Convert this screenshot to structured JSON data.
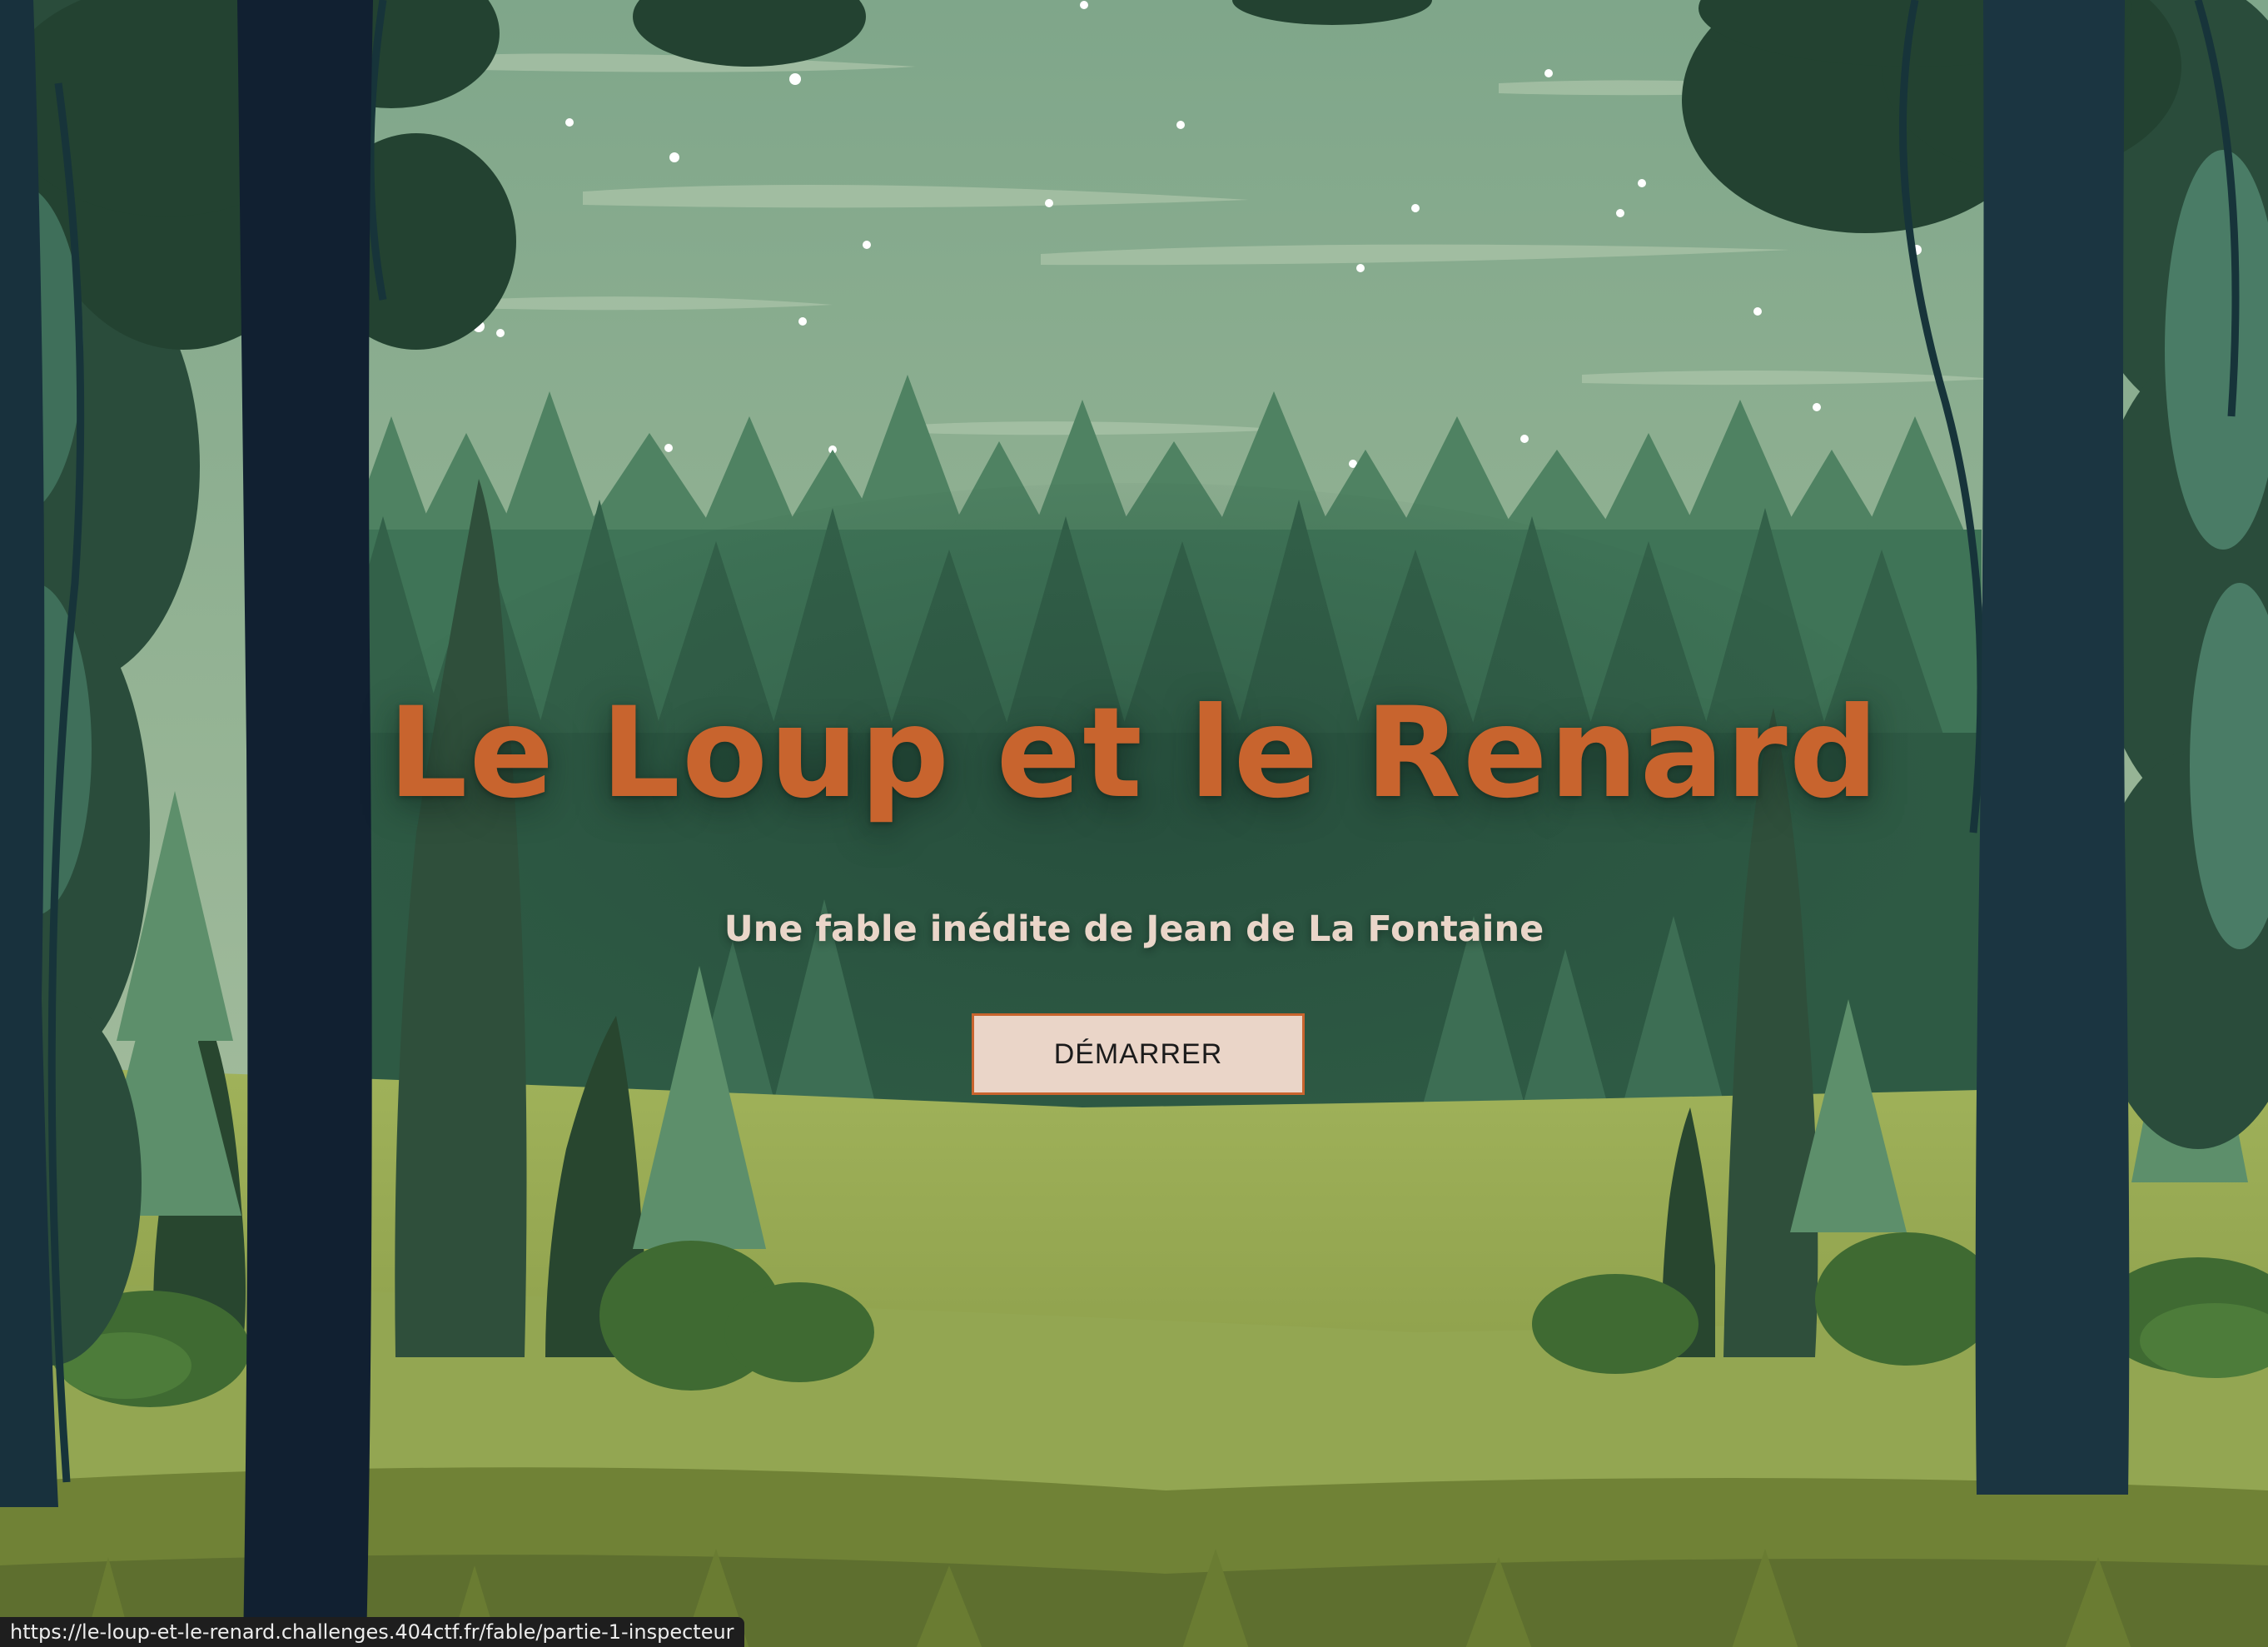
{
  "hero": {
    "title": "Le Loup et le Renard",
    "subtitle": "Une fable inédite de Jean de La Fontaine",
    "start_button_label": "DÉMARRER"
  },
  "status_bar": {
    "url": "https://le-loup-et-le-renard.challenges.404ctf.fr/fable/partie-1-inspecteur"
  },
  "colors": {
    "title": "#c8642e",
    "subtitle": "#ead6c9",
    "button_background": "#ead5c8",
    "button_border": "#c8642e",
    "sky": "#8aac8d",
    "meadow": "#8fa34f",
    "tree_trunk": "#112031"
  },
  "icons": {
    "background": "forest-illustration"
  }
}
